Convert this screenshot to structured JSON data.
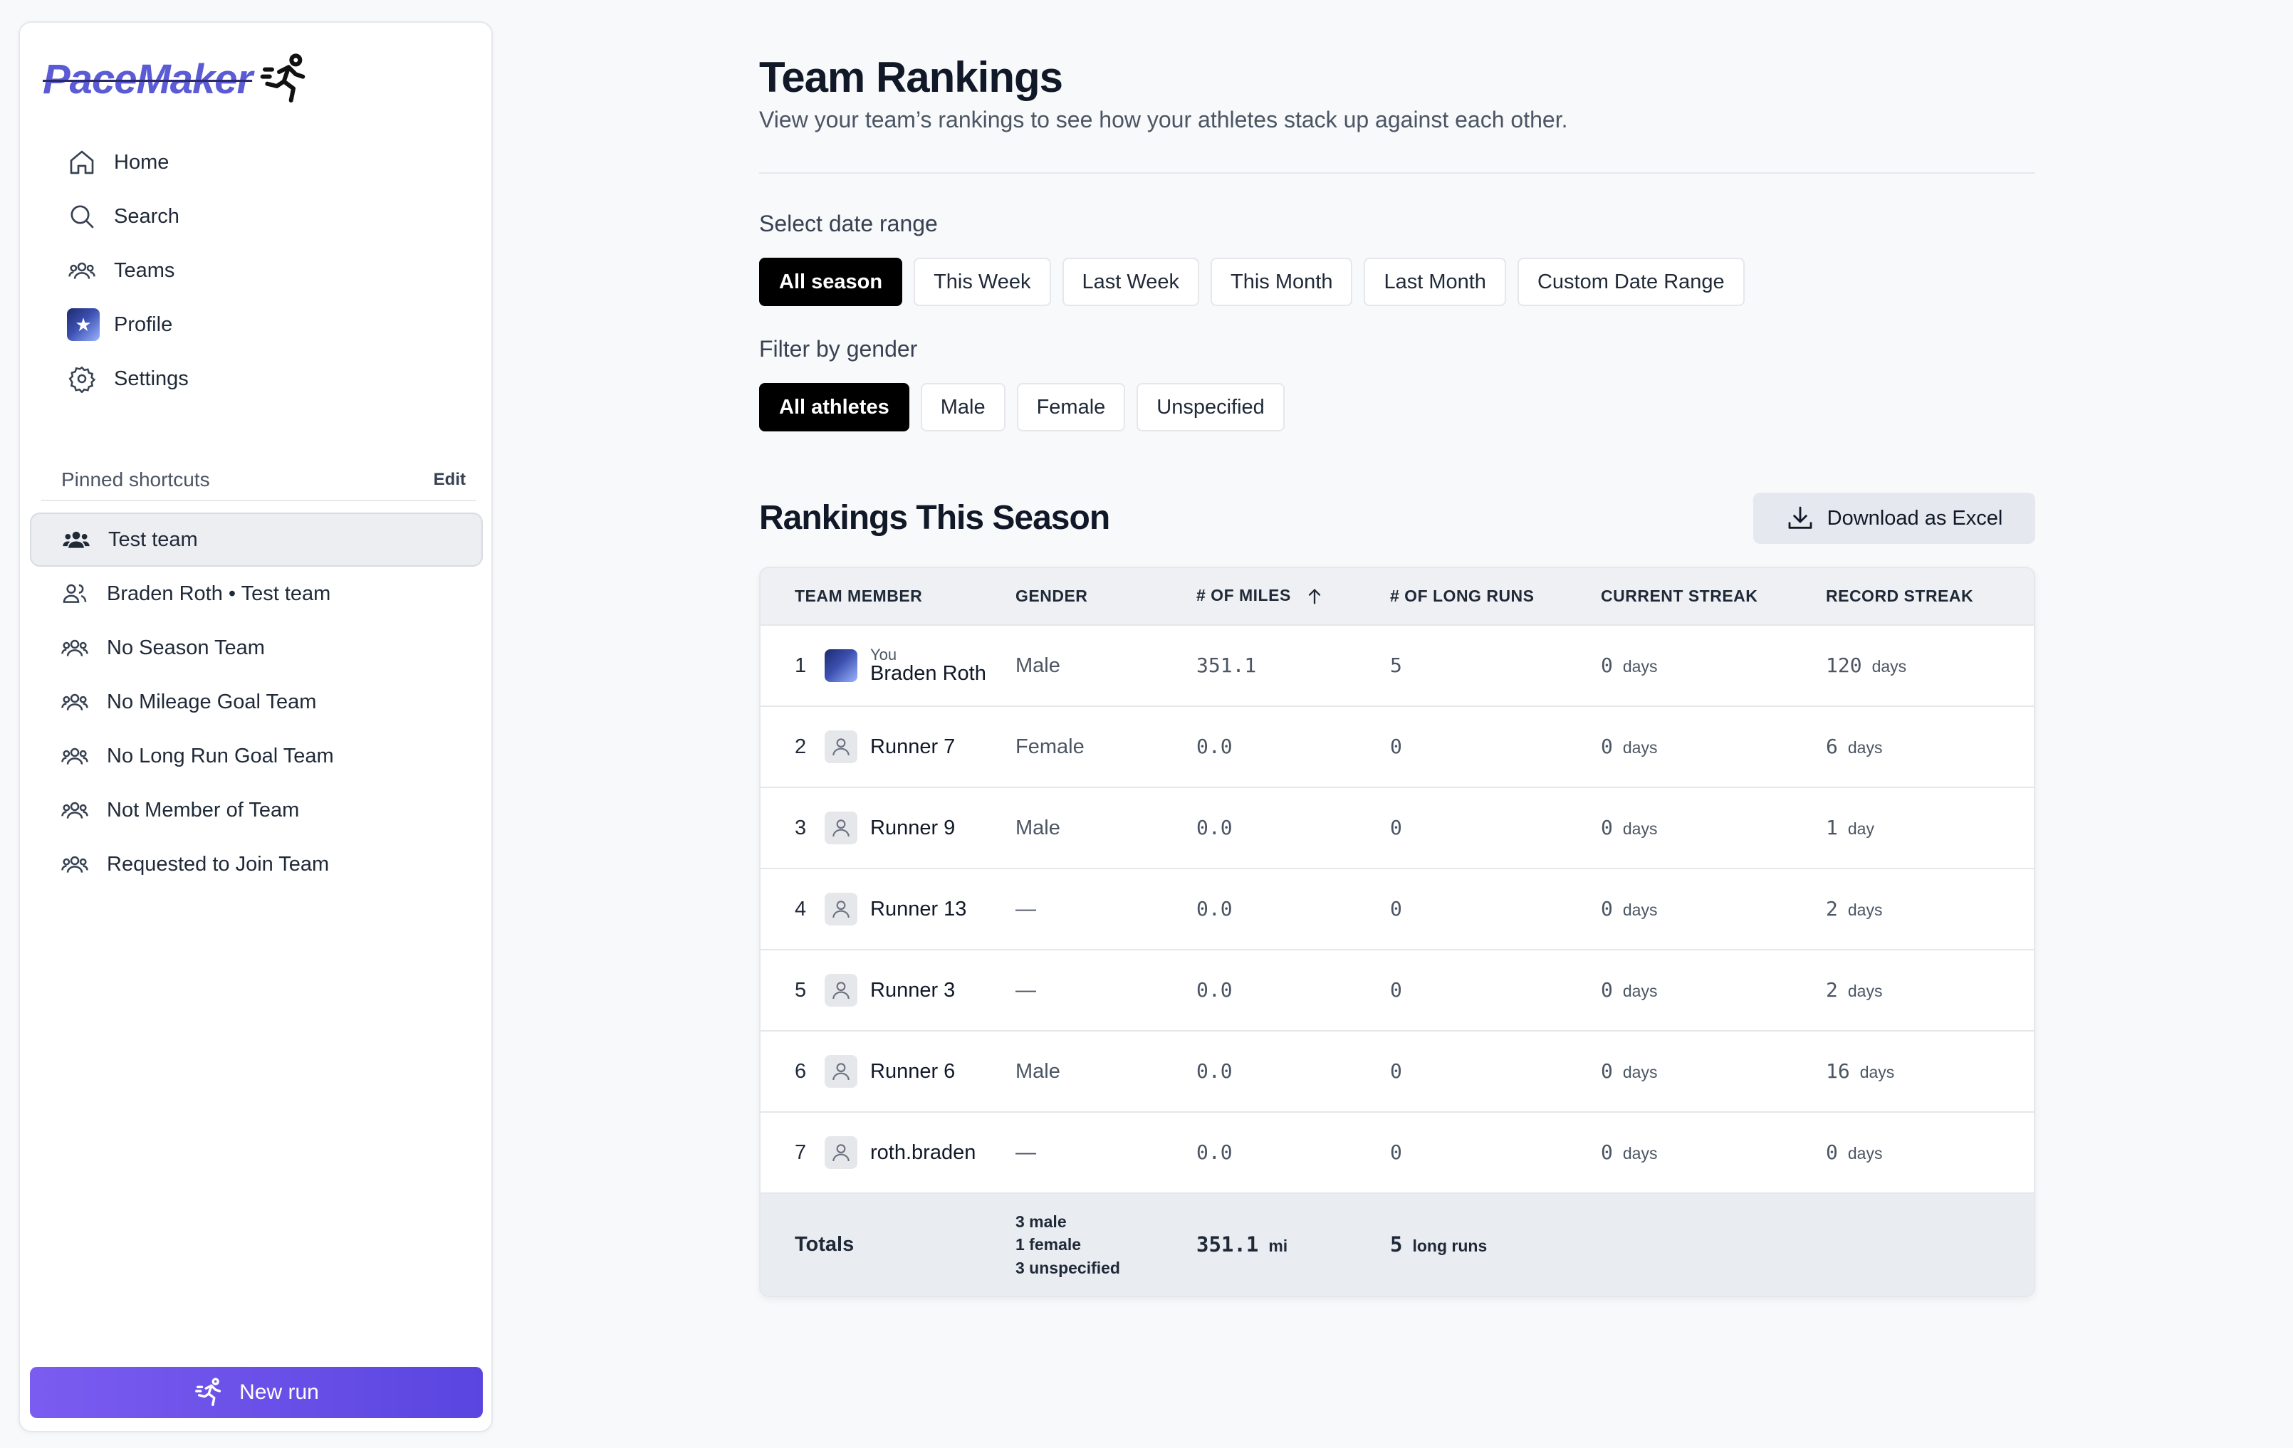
{
  "app": {
    "name": "PaceMaker"
  },
  "nav": {
    "home": "Home",
    "search": "Search",
    "teams": "Teams",
    "profile": "Profile",
    "settings": "Settings"
  },
  "pinned": {
    "title": "Pinned shortcuts",
    "edit": "Edit",
    "items": [
      "Test team",
      "Braden Roth • Test team",
      "No Season Team",
      "No Mileage Goal Team",
      "No Long Run Goal Team",
      "Not Member of Team",
      "Requested to Join Team"
    ]
  },
  "new_run": "New run",
  "page": {
    "title": "Team Rankings",
    "subtitle": "View your team’s rankings to see how your athletes stack up against each other."
  },
  "date_range": {
    "label": "Select date range",
    "options": [
      "All season",
      "This Week",
      "Last Week",
      "This Month",
      "Last Month",
      "Custom Date Range"
    ],
    "selected": "All season"
  },
  "gender_filter": {
    "label": "Filter by gender",
    "options": [
      "All athletes",
      "Male",
      "Female",
      "Unspecified"
    ],
    "selected": "All athletes"
  },
  "rankings": {
    "title": "Rankings This Season",
    "download": "Download as Excel",
    "columns": [
      "TEAM MEMBER",
      "GENDER",
      "# OF MILES",
      "# OF LONG RUNS",
      "CURRENT STREAK",
      "RECORD STREAK"
    ],
    "rows": [
      {
        "rank": "1",
        "you": "You",
        "name": "Braden Roth",
        "gender": "Male",
        "miles": "351.1",
        "long_runs": "5",
        "current": "0",
        "current_unit": "days",
        "record": "120",
        "record_unit": "days"
      },
      {
        "rank": "2",
        "name": "Runner 7",
        "gender": "Female",
        "miles": "0.0",
        "long_runs": "0",
        "current": "0",
        "current_unit": "days",
        "record": "6",
        "record_unit": "days"
      },
      {
        "rank": "3",
        "name": "Runner 9",
        "gender": "Male",
        "miles": "0.0",
        "long_runs": "0",
        "current": "0",
        "current_unit": "days",
        "record": "1",
        "record_unit": "day"
      },
      {
        "rank": "4",
        "name": "Runner 13",
        "gender": "—",
        "miles": "0.0",
        "long_runs": "0",
        "current": "0",
        "current_unit": "days",
        "record": "2",
        "record_unit": "days"
      },
      {
        "rank": "5",
        "name": "Runner 3",
        "gender": "—",
        "miles": "0.0",
        "long_runs": "0",
        "current": "0",
        "current_unit": "days",
        "record": "2",
        "record_unit": "days"
      },
      {
        "rank": "6",
        "name": "Runner 6",
        "gender": "Male",
        "miles": "0.0",
        "long_runs": "0",
        "current": "0",
        "current_unit": "days",
        "record": "16",
        "record_unit": "days"
      },
      {
        "rank": "7",
        "name": "roth.braden",
        "gender": "—",
        "miles": "0.0",
        "long_runs": "0",
        "current": "0",
        "current_unit": "days",
        "record": "0",
        "record_unit": "days"
      }
    ],
    "totals": {
      "label": "Totals",
      "male": "3 male",
      "female": "1 female",
      "unspecified": "3 unspecified",
      "miles": "351.1",
      "miles_unit": "mi",
      "long_runs": "5",
      "long_runs_unit": "long runs"
    }
  }
}
